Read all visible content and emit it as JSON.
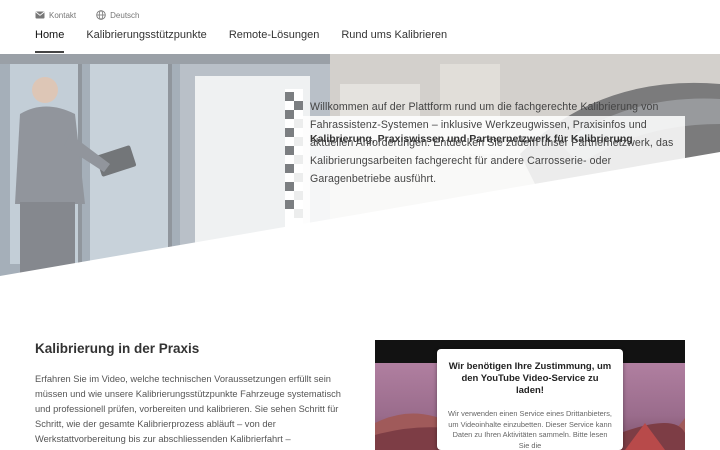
{
  "topbar": {
    "contact_label": "Kontakt",
    "language_label": "Deutsch",
    "contact_icon": "mail-icon",
    "language_icon": "globe-icon"
  },
  "nav": {
    "items": [
      {
        "label": "Home",
        "active": true
      },
      {
        "label": "Kalibrierungsstützpunkte",
        "active": false
      },
      {
        "label": "Remote-Lösungen",
        "active": false
      },
      {
        "label": "Rund ums Kalibrieren",
        "active": false
      }
    ]
  },
  "hero": {
    "title": "Kalibrierung, Praxiswissen und Partnernetzwerk für Kalibrierung",
    "text": "Willkommen auf der Plattform rund um die fachgerechte Kalibrierung von Fahrassistenz-Systemen – inklusive Werkzeugwissen, Praxisinfos und aktuellen Anforderungen. Entdecken Sie zudem unser Partnernetzwerk, das Kalibrierungsarbeiten fachgerecht für andere Carrosserie- oder Garagenbetriebe ausführt."
  },
  "section": {
    "title": "Kalibrierung in der Praxis",
    "text": "Erfahren Sie im Video, welche technischen Voraussetzungen erfüllt sein müssen und wie unsere Kalibrierungsstützpunkte Fahrzeuge systematisch und professionell prüfen, vorbereiten und kalibrieren. Sie sehen Schritt für Schritt, wie der gesamte Kalibrierprozess abläuft – von der Werkstattvorbereitung bis zur abschliessenden Kalibrierfahrt –"
  },
  "video": {
    "consent_title": "Wir benötigen Ihre Zustimmung, um den YouTube Video-Service zu laden!",
    "consent_text": "Wir verwenden einen Service eines Drittanbieters, um Videoinhalte einzubetten. Dieser Service kann Daten zu Ihren Aktivitäten sammeln. Bitte lesen Sie die"
  },
  "colors": {
    "nav_active_underline": "#444444",
    "video_background": "#121212"
  }
}
